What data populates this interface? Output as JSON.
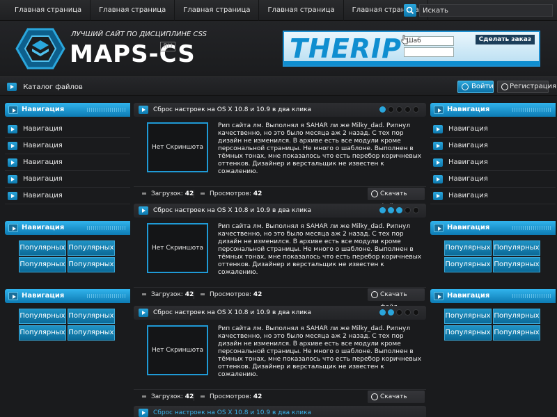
{
  "topnav": {
    "items": [
      "Главная страница",
      "Главная страница",
      "Главная страница",
      "Главная страница",
      "Главная страница"
    ]
  },
  "search": {
    "placeholder": "Искать"
  },
  "header": {
    "tagline": "Лучший сайт по дисциплине CSS",
    "logo_main": "MAPS-CS",
    "logo_ru": "RU"
  },
  "banner": {
    "brand": "THERIP",
    "field_value": "Шаб",
    "order_button": "Сделать заказ"
  },
  "catalog": {
    "label": "Каталог файлов"
  },
  "auth": {
    "login": "Войти",
    "register": "Регистрация"
  },
  "sidebar_left": {
    "nav_title": "Навигация",
    "nav_items": [
      "Навигация",
      "Навигация",
      "Навигация",
      "Навигация",
      "Навигация"
    ],
    "block2_title": "Навигация",
    "block2_items": [
      "Популярных",
      "Популярных",
      "Популярных",
      "Популярных"
    ],
    "block3_title": "Навигация",
    "block3_items": [
      "Популярных",
      "Популярных",
      "Популярных",
      "Популярных"
    ]
  },
  "sidebar_right": {
    "nav_title": "Навигация",
    "nav_items": [
      "Навигация",
      "Навигация",
      "Навигация",
      "Навигация",
      "Навигация"
    ],
    "block2_title": "Навигация",
    "block2_items": [
      "Популярных",
      "Популярных",
      "Популярных",
      "Популярных"
    ],
    "block3_title": "Навигация",
    "block3_items": [
      "Популярных",
      "Популярных",
      "Популярных",
      "Популярных"
    ]
  },
  "posts": [
    {
      "title": "Сброс настроек на OS X 10.8 и 10.9 в два клика",
      "rating": 1,
      "shot": "Нет Скриншота",
      "text": "Рип сайта лм. Выполнял я SAHAR ли же Milky_dad. Рипнул качественно, но это было месяца аж 2 назад. С тех пор дизайн не изменился. В архиве есть все модули кроме персональной страницы. Не много о шаблоне. Выполнен в тёмных тонах, мне показалось что есть перебор коричневых оттенков. Дизайнер и верстальщик не известен к сожалению.",
      "downloads_label": "Загрузок:",
      "downloads": "42",
      "views_label": "Просмотров:",
      "views": "42",
      "download_button": "Скачать файл"
    },
    {
      "title": "Сброс настроек на OS X 10.8 и 10.9 в два клика",
      "rating": 3,
      "shot": "Нет Скриншота",
      "text": "Рип сайта лм. Выполнял я SAHAR ли же Milky_dad. Рипнул качественно, но это было месяца аж 2 назад. С тех пор дизайн не изменился. В архиве есть все модули кроме персональной страницы. Не много о шаблоне. Выполнен в тёмных тонах, мне показалось что есть перебор коричневых оттенков. Дизайнер и верстальщик не известен к сожалению.",
      "downloads_label": "Загрузок:",
      "downloads": "42",
      "views_label": "Просмотров:",
      "views": "42",
      "download_button": "Скачать файл"
    },
    {
      "title": "Сброс настроек на OS X 10.8 и 10.9 в два клика",
      "rating": 2,
      "shot": "Нет Скриншота",
      "text": "Рип сайта лм. Выполнял я SAHAR ли же Milky_dad. Рипнул качественно, но это было месяца аж 2 назад. С тех пор дизайн не изменился. В архиве есть все модули кроме персональной страницы. Не много о шаблоне. Выполнен в тёмных тонах, мне показалось что есть перебор коричневых оттенков. Дизайнер и верстальщик не известен к сожалению.",
      "downloads_label": "Загрузок:",
      "downloads": "42",
      "views_label": "Просмотров:",
      "views": "42",
      "download_button": "Скачать файл"
    },
    {
      "title": "Сброс настроек на OS X 10.8 и 10.9 в два клика"
    }
  ],
  "colors": {
    "accent": "#1f9ad6",
    "background": "#1a1b1d"
  }
}
